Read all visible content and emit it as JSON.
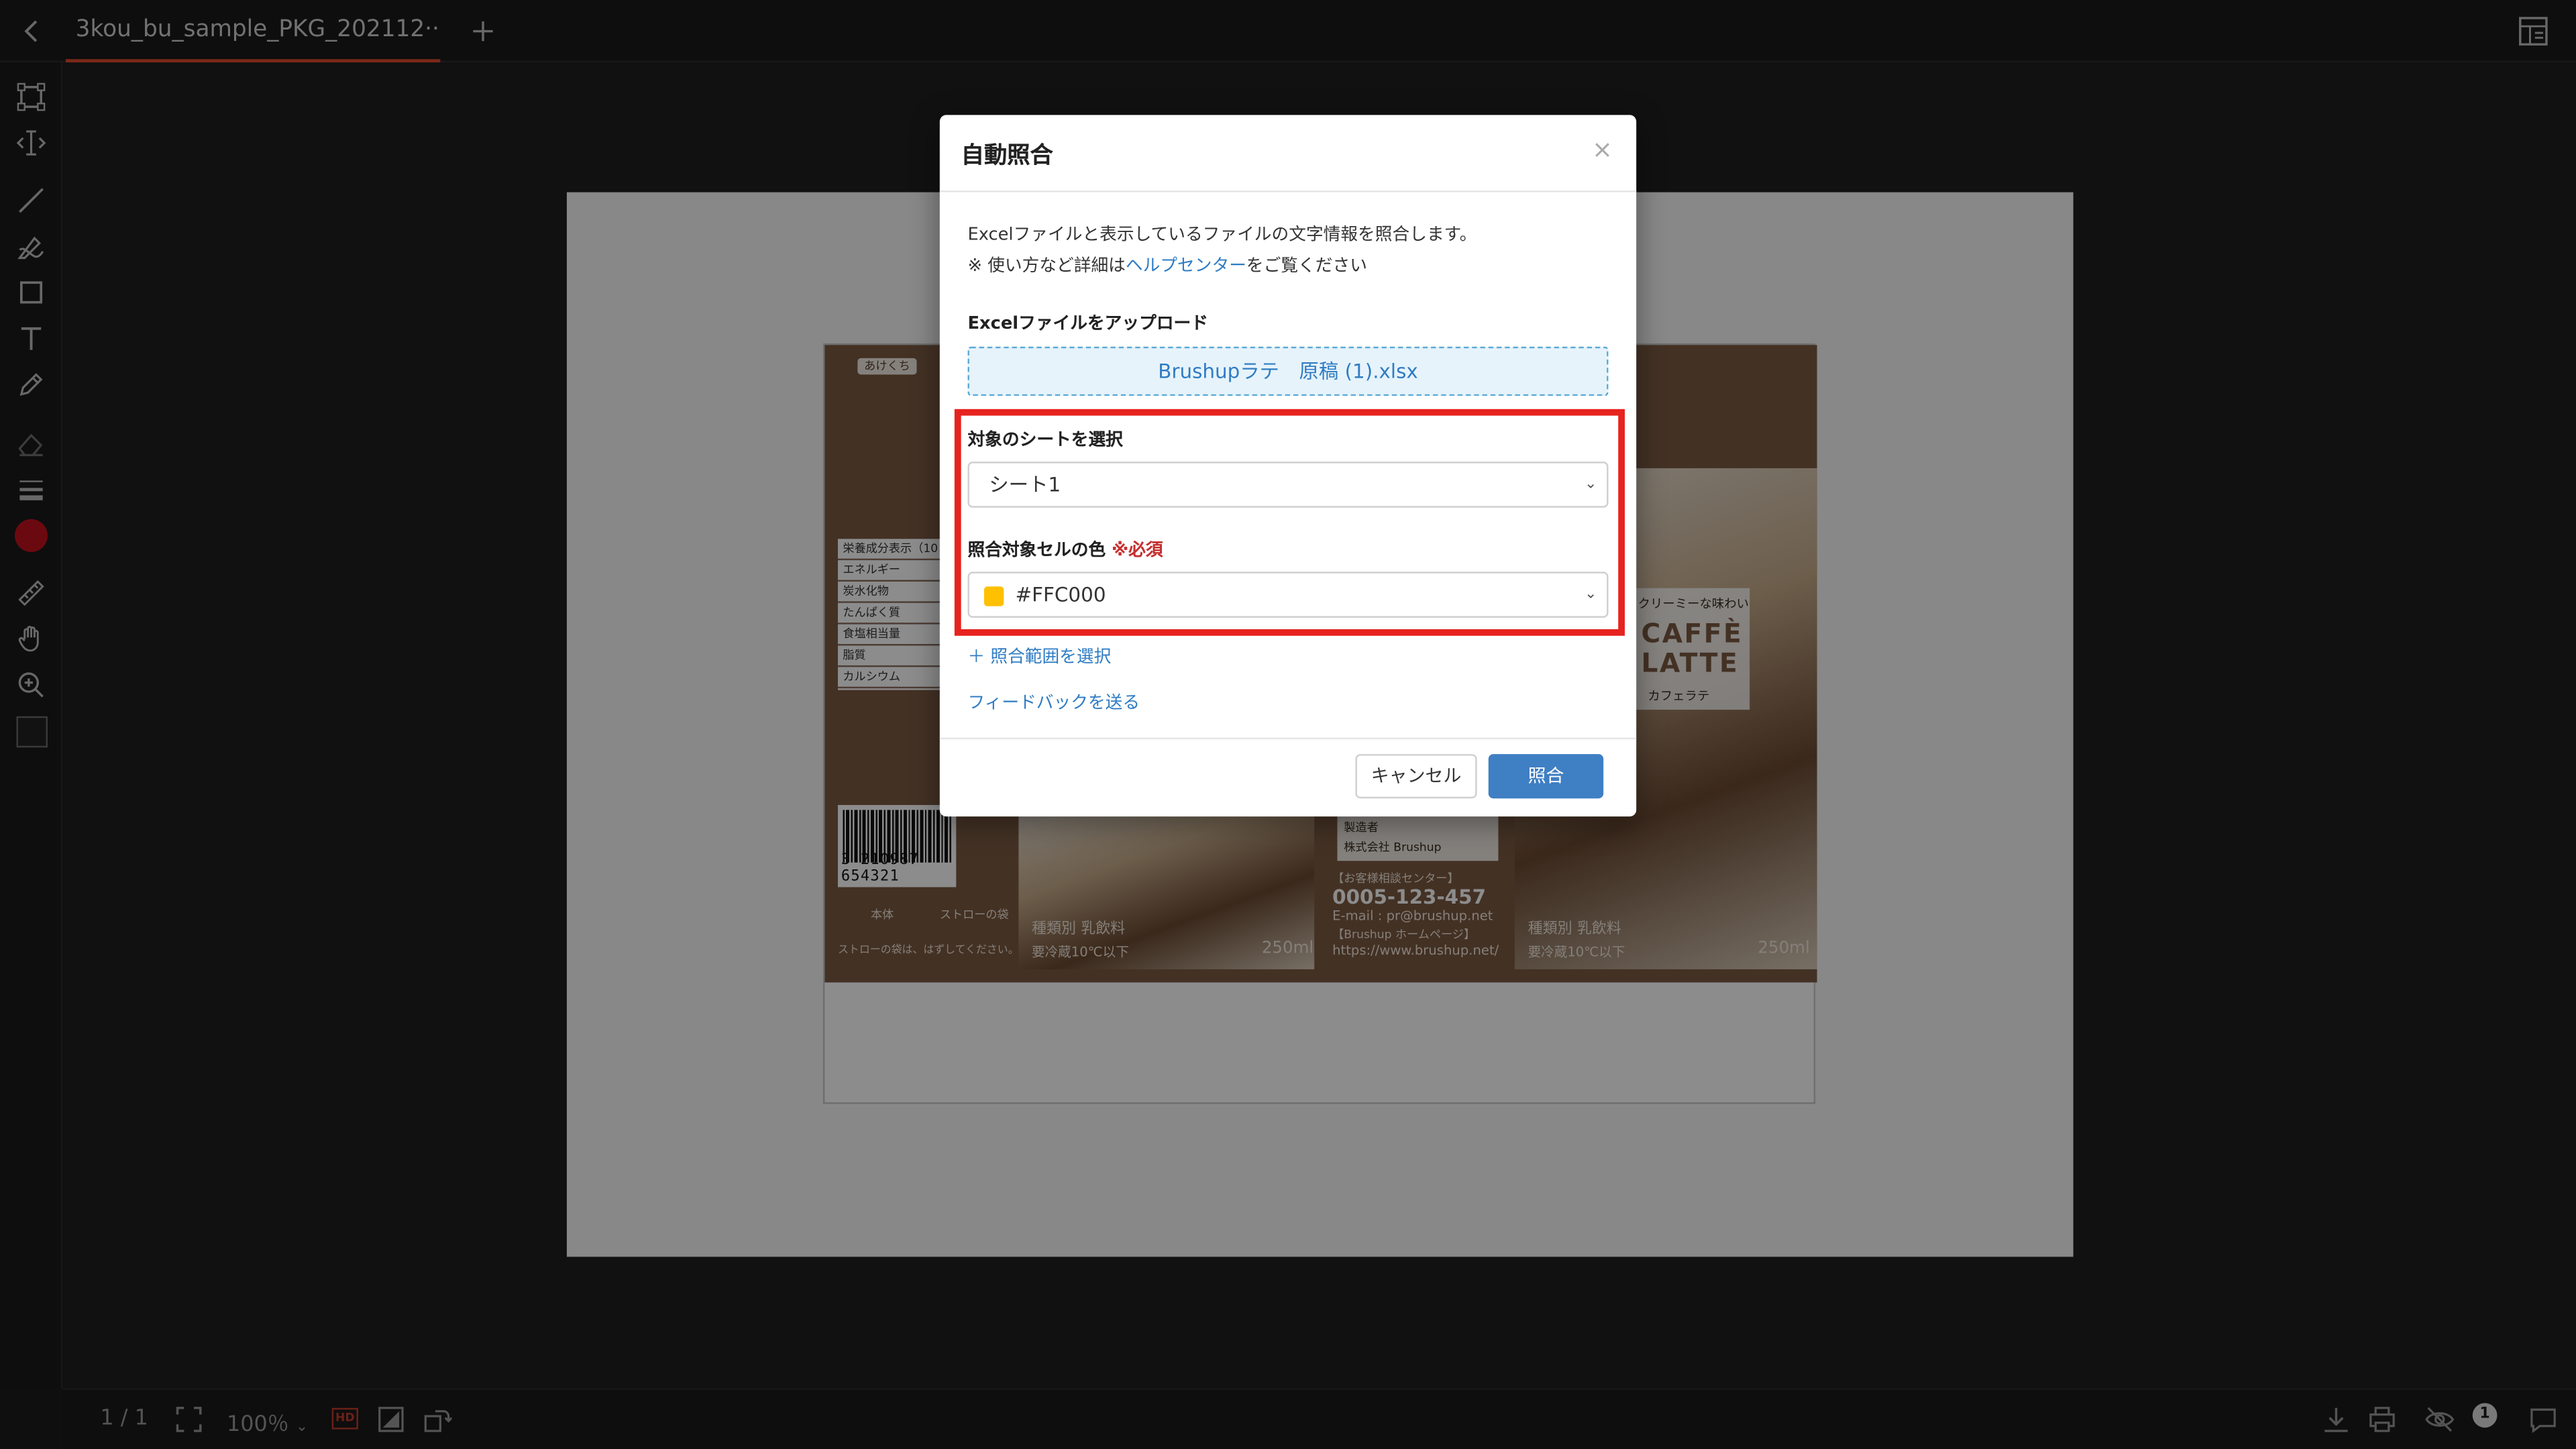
{
  "tab": {
    "title": "3kou_bu_sample_PKG_202112···"
  },
  "modal": {
    "title": "自動照合",
    "close": "×",
    "description_line1": "Excelファイルと表示しているファイルの文字情報を照合します。",
    "description_line2_prefix": "※ 使い方など詳細は",
    "description_line2_link": "ヘルプセンター",
    "description_line2_suffix": "をご覧ください",
    "upload_label": "Excelファイルをアップロード",
    "upload_file": "Brushupラテ　原稿 (1).xlsx",
    "sheet_label": "対象のシートを選択",
    "sheet_value": "シート1",
    "color_label": "照合対象セルの色",
    "color_required": "※必須",
    "color_value": "#FFC000",
    "range_link": "＋ 照合範囲を選択",
    "feedback_link": "フィードバックを送る",
    "cancel_button": "キャンセル",
    "submit_button": "照合"
  },
  "package": {
    "nutrition_rows": [
      "栄養成分表示（10",
      "エネルギー",
      "炭水化物",
      "たんぱく質",
      "食塩相当量",
      "脂質",
      "カルシウム"
    ],
    "barcode_number": "3 210987 654321",
    "type1": "種類別 乳飲料",
    "storage": "要冷蔵10℃以下",
    "volume": "250ml",
    "maker_label": "製造者",
    "maker_name": "株式会社 Brushup",
    "support_label": "【お客様相談センター】",
    "support_phone": "0005-123-457",
    "support_email": "E-mail : pr@brushup.net",
    "homepage_label": "【Brushup ホームページ】",
    "homepage_url": "https://www.brushup.net/",
    "tagline": "クリーミーな味わい",
    "caffe1": "CAFFÈ",
    "caffe2": "LATTE",
    "caffe_sub": "カフェラテ",
    "straw_label": "ストローの袋は、はずしてください。",
    "open_label": "あけくち",
    "body_label": "本体",
    "straw_bag_label": "ストローの袋"
  },
  "statusbar": {
    "page_indicator": "1 / 1",
    "zoom": "100％",
    "hd_label": "HD",
    "notification_count": "1"
  },
  "colors": {
    "accent_tab": "#e04a2f",
    "highlight_border": "#e7231f",
    "primary_button": "#3f7fc3",
    "link": "#2f7cc3",
    "selected_swatch": "#FFC000",
    "brush_color": "#c4121e"
  },
  "icons": {
    "topbar": [
      "back-icon",
      "add-tab-icon",
      "layout-icon"
    ],
    "tools": [
      "select-box-icon",
      "text-cursor-icon",
      "line-icon",
      "pen-icon",
      "rectangle-icon",
      "text-icon",
      "marker-icon",
      "eraser-icon",
      "stroke-width-icon",
      "color-icon",
      "ruler-icon",
      "hand-icon",
      "zoom-icon",
      "swatch-icon"
    ],
    "bottom": [
      "fit-screen-icon",
      "compare-icon",
      "rotate-icon",
      "download-icon",
      "print-icon",
      "hide-icon",
      "comment-icon"
    ]
  }
}
